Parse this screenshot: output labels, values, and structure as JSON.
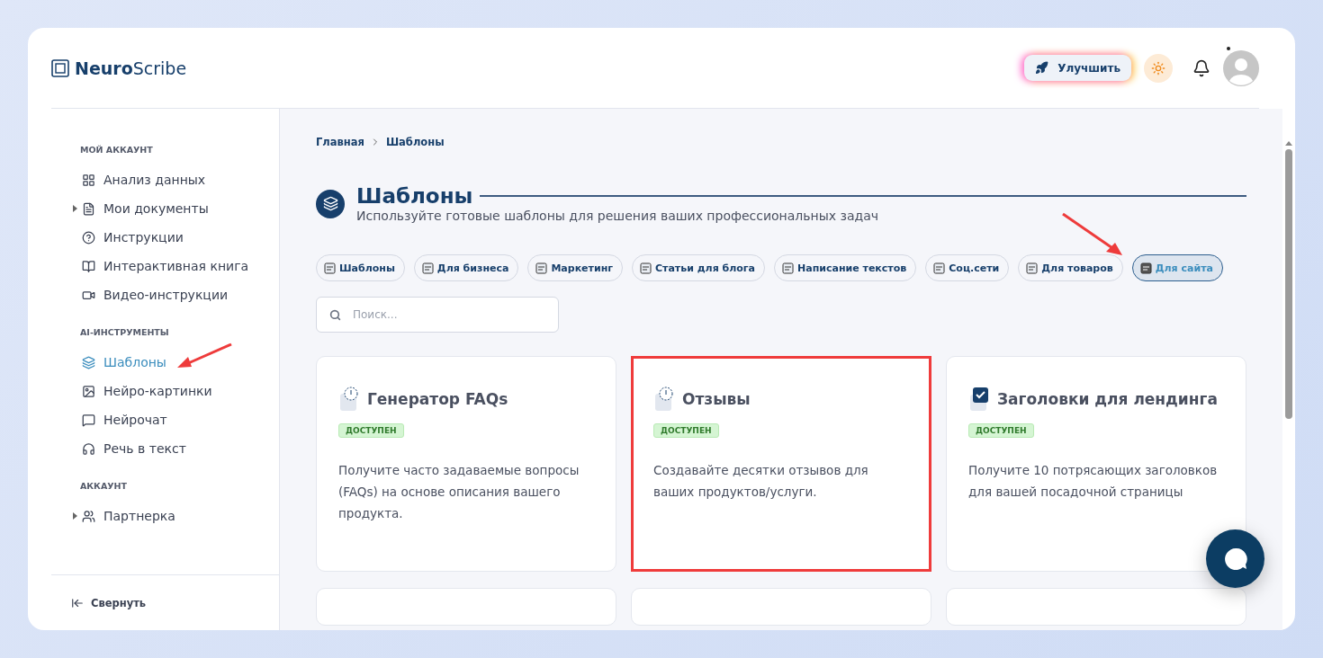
{
  "brand": {
    "bold": "Neuro",
    "light": "Scribe"
  },
  "header": {
    "upgrade": "Улучшить",
    "notification_dot": true
  },
  "sidebar": {
    "sections": [
      {
        "title": "МОЙ АККАУНТ",
        "items": [
          {
            "label": "Анализ данных",
            "kind": "grid",
            "expandable": false,
            "selected": false
          },
          {
            "label": "Мои документы",
            "kind": "file",
            "expandable": true,
            "selected": false
          },
          {
            "label": "Инструкции",
            "kind": "help",
            "expandable": false,
            "selected": false
          },
          {
            "label": "Интерактивная книга",
            "kind": "book",
            "expandable": false,
            "selected": false
          },
          {
            "label": "Видео-инструкции",
            "kind": "video",
            "expandable": false,
            "selected": false
          }
        ]
      },
      {
        "title": "AI-ИНСТРУМЕНТЫ",
        "items": [
          {
            "label": "Шаблоны",
            "kind": "layers",
            "expandable": false,
            "selected": true
          },
          {
            "label": "Нейро-картинки",
            "kind": "image",
            "expandable": false,
            "selected": false
          },
          {
            "label": "Нейрочат",
            "kind": "chat",
            "expandable": false,
            "selected": false
          },
          {
            "label": "Речь в текст",
            "kind": "headphones",
            "expandable": false,
            "selected": false
          }
        ]
      },
      {
        "title": "АККАУНТ",
        "items": [
          {
            "label": "Партнерка",
            "kind": "users",
            "expandable": true,
            "selected": false
          }
        ]
      }
    ],
    "collapse": "Свернуть"
  },
  "breadcrumbs": [
    "Главная",
    "Шаблоны"
  ],
  "page": {
    "title": "Шаблоны",
    "subtitle": "Используйте готовые шаблоны для решения ваших профессиональных задач"
  },
  "categories": [
    {
      "label": "Шаблоны",
      "selected": false
    },
    {
      "label": "Для бизнеса",
      "selected": false
    },
    {
      "label": "Маркетинг",
      "selected": false
    },
    {
      "label": "Статьи для блога",
      "selected": false
    },
    {
      "label": "Написание текстов",
      "selected": false
    },
    {
      "label": "Соц.сети",
      "selected": false
    },
    {
      "label": "Для товаров",
      "selected": false
    },
    {
      "label": "Для сайта",
      "selected": true
    }
  ],
  "search": {
    "placeholder": "Поиск..."
  },
  "templates": [
    {
      "title": "Генератор FAQs",
      "kind": "clock",
      "badge": "ДОСТУПЕН",
      "description": "Получите часто задаваемые вопросы (FAQs) на основе описания вашего продукта.",
      "highlighted": false
    },
    {
      "title": "Отзывы",
      "kind": "clock",
      "badge": "ДОСТУПЕН",
      "description": "Создавайте десятки отзывов для ваших продуктов/услуги.",
      "highlighted": true
    },
    {
      "title": "Заголовки для лендинга",
      "kind": "check",
      "badge": "ДОСТУПЕН",
      "description": "Получите 10 потрясающих заголовков для вашей посадочной страницы",
      "highlighted": false
    }
  ]
}
